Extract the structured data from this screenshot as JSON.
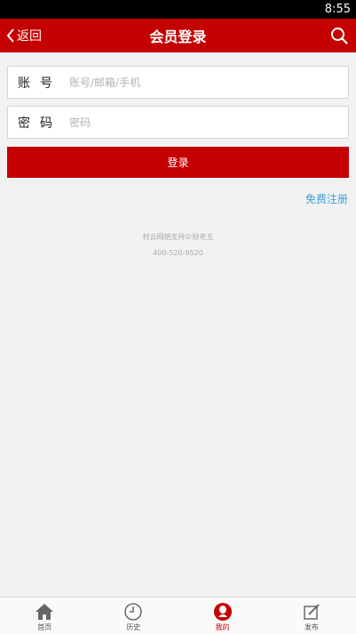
{
  "status": {
    "time": "8:55"
  },
  "header": {
    "back_label": "返回",
    "title": "会员登录",
    "search_icon": "search-icon"
  },
  "form": {
    "account_label": "账号",
    "account_placeholder": "账号/邮箱/手机",
    "password_label": "密码",
    "password_placeholder": "密码",
    "login_label": "登录"
  },
  "register_label": "免费注册",
  "footer": {
    "support": "材云网络支持©财老五",
    "phone": "400-520-9520"
  },
  "tabs": [
    {
      "label": "首页",
      "icon": "home-icon"
    },
    {
      "label": "历史",
      "icon": "clock-icon"
    },
    {
      "label": "我的",
      "icon": "user-icon"
    },
    {
      "label": "发布",
      "icon": "edit-icon"
    }
  ],
  "colors": {
    "brand": "#c40000",
    "link": "#3a9fd8"
  }
}
